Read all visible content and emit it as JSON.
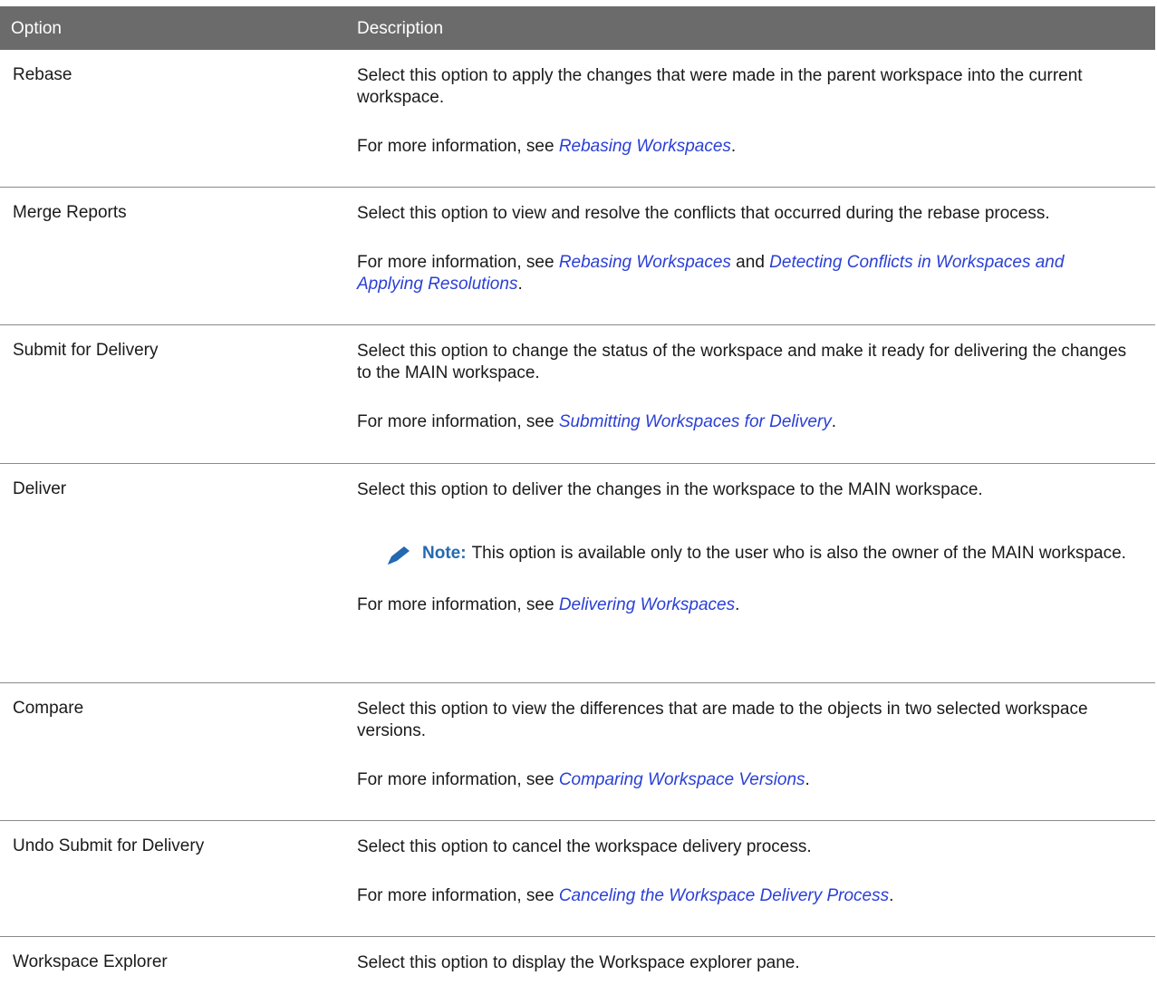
{
  "header": {
    "option": "Option",
    "description": "Description"
  },
  "rows": [
    {
      "option": "Rebase",
      "desc": "Select this option to apply the changes that were made in the parent workspace into the current workspace.",
      "more_prefix": "For more information, see ",
      "link1": "Rebasing Workspaces",
      "suffix": "."
    },
    {
      "option": "Merge Reports",
      "desc": "Select this option to view and resolve the conflicts that occurred during the rebase process.",
      "more_prefix": "For more information, see ",
      "link1": "Rebasing Workspaces",
      "mid": " and ",
      "link2": "Detecting Conflicts in Workspaces and Applying Resolutions",
      "suffix": "."
    },
    {
      "option": "Submit for Delivery",
      "desc": "Select this option to change the status of the workspace and make it ready for delivering the changes to the MAIN workspace.",
      "more_prefix": "For more information, see ",
      "link1": "Submitting Workspaces for Delivery",
      "suffix": "."
    },
    {
      "option": "Deliver",
      "desc": "Select this option to deliver the changes in the workspace to the MAIN workspace.",
      "note_label": "Note:",
      "note_text": "This option is available only to the user who is also the owner of the MAIN workspace.",
      "more_prefix": "For more information, see ",
      "link1": "Delivering Workspaces",
      "suffix": "."
    },
    {
      "option": "Compare",
      "desc": "Select this option to view the differences that are made to the objects in two selected workspace versions.",
      "more_prefix": "For more information, see ",
      "link1": "Comparing Workspace Versions",
      "suffix": "."
    },
    {
      "option": "Undo Submit for Delivery",
      "desc": "Select this option to cancel the workspace delivery process.",
      "more_prefix": "For more information, see ",
      "link1": "Canceling the Workspace Delivery Process",
      "suffix": "."
    },
    {
      "option": "Workspace Explorer",
      "desc": "Select this option to display the Workspace explorer pane."
    }
  ],
  "colors": {
    "header_bg": "#6b6b6b",
    "link": "#2a3fd6",
    "note_label": "#2469b0"
  },
  "icons": {
    "note": "pencil-icon"
  }
}
